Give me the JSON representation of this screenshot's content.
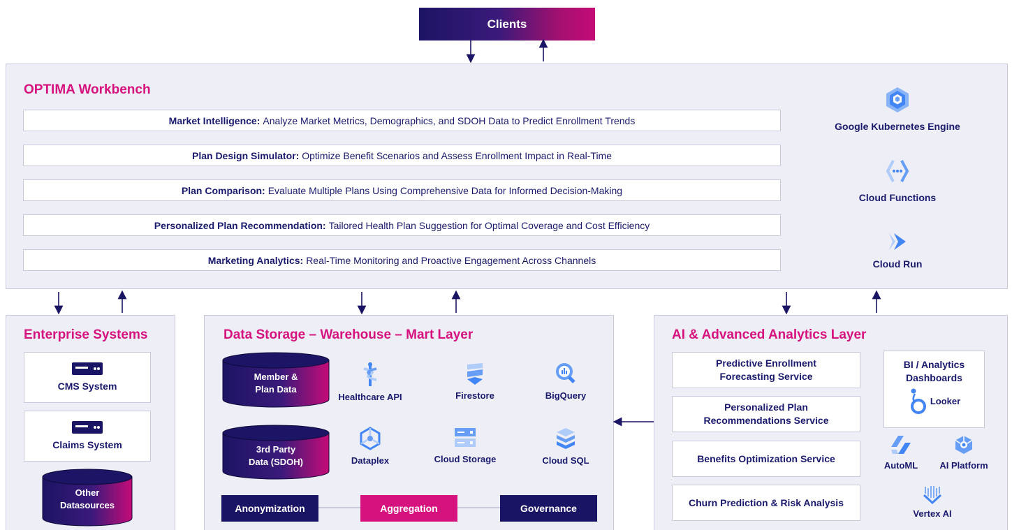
{
  "clients": {
    "label": "Clients"
  },
  "workbench": {
    "title": "OPTIMA Workbench",
    "features": [
      {
        "title": "Market Intelligence:",
        "desc": "Analyze Market Metrics, Demographics, and SDOH Data to Predict Enrollment Trends"
      },
      {
        "title": "Plan Design Simulator:",
        "desc": "Optimize Benefit Scenarios and Assess Enrollment Impact in Real-Time"
      },
      {
        "title": "Plan Comparison:",
        "desc": "Evaluate Multiple Plans Using Comprehensive Data for Informed Decision-Making"
      },
      {
        "title": "Personalized Plan Recommendation:",
        "desc": "Tailored Health Plan Suggestion for Optimal Coverage and Cost Efficiency"
      },
      {
        "title": "Marketing Analytics:",
        "desc": "Real-Time Monitoring and Proactive Engagement Across Channels"
      }
    ],
    "compute": [
      {
        "label": "Google Kubernetes Engine",
        "icon": "kubernetes-engine-icon"
      },
      {
        "label": "Cloud Functions",
        "icon": "cloud-functions-icon"
      },
      {
        "label": "Cloud Run",
        "icon": "cloud-run-icon"
      }
    ]
  },
  "enterprise": {
    "title": "Enterprise Systems",
    "systems": [
      {
        "label": "CMS System",
        "icon": "server-icon"
      },
      {
        "label": "Claims System",
        "icon": "server-icon"
      }
    ],
    "other_line1": "Other",
    "other_line2": "Datasources"
  },
  "storage": {
    "title": "Data Storage – Warehouse – Mart Layer",
    "db1_line1": "Member &",
    "db1_line2": "Plan Data",
    "db2_line1": "3rd Party",
    "db2_line2": "Data (SDOH)",
    "services": [
      {
        "label": "Healthcare API",
        "icon": "healthcare-api-icon"
      },
      {
        "label": "Firestore",
        "icon": "firestore-icon"
      },
      {
        "label": "BigQuery",
        "icon": "bigquery-icon"
      },
      {
        "label": "Dataplex",
        "icon": "dataplex-icon"
      },
      {
        "label": "Cloud Storage",
        "icon": "cloud-storage-icon"
      },
      {
        "label": "Cloud SQL",
        "icon": "cloud-sql-icon"
      }
    ],
    "pills": [
      "Anonymization",
      "Aggregation",
      "Governance"
    ]
  },
  "ai": {
    "title": "AI & Advanced Analytics Layer",
    "services": [
      {
        "line1": "Predictive Enrollment",
        "line2": "Forecasting Service"
      },
      {
        "line1": "Personalized Plan",
        "line2": "Recommendations Service"
      },
      {
        "line1": "Benefits Optimization Service",
        "line2": ""
      },
      {
        "line1": "Churn Prediction & Risk Analysis",
        "line2": ""
      }
    ],
    "bi_line1": "BI / Analytics",
    "bi_line2": "Dashboards",
    "looker": "Looker",
    "automl": "AutoML",
    "ai_platform": "AI Platform",
    "vertex": "Vertex AI"
  },
  "colors": {
    "navy": "#1a1464",
    "magenta": "#d6127f",
    "panel": "#eeeef6",
    "gcp_blue": "#4285f4"
  }
}
